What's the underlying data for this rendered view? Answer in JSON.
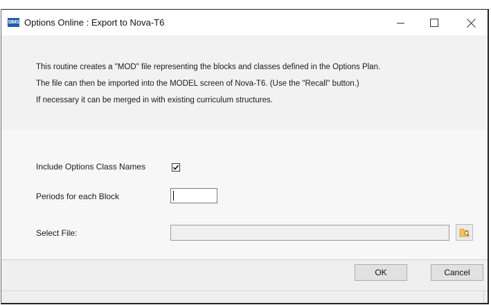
{
  "window": {
    "app_icon_text": "SIMS",
    "title": "Options Online : Export to Nova-T6"
  },
  "info": {
    "line1": "This routine creates a \"MOD\" file representing the blocks and classes defined in the Options Plan.",
    "line2": "The file can then be imported into the MODEL screen of Nova-T6. (Use the \"Recall\" button.)",
    "line3": "If necessary it can be merged in with existing curriculum structures."
  },
  "form": {
    "include_class_names_label": "Include Options Class Names",
    "include_class_names_checked": true,
    "periods_label": "Periods for each Block",
    "periods_value": "",
    "select_file_label": "Select File:",
    "select_file_value": ""
  },
  "footer": {
    "ok_label": "OK",
    "cancel_label": "Cancel"
  },
  "icons": {
    "browse": "folder-search-icon",
    "minimize": "minimize-icon",
    "maximize": "maximize-icon",
    "close": "close-icon"
  }
}
